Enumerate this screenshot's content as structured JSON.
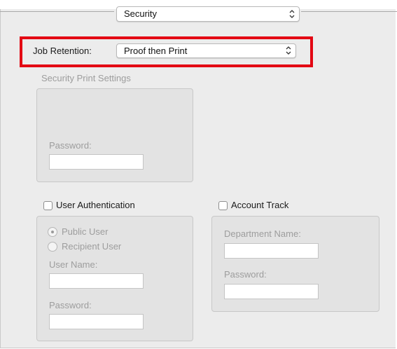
{
  "section_popup": {
    "value": "Security"
  },
  "job_retention": {
    "label": "Job Retention:",
    "value": "Proof then Print"
  },
  "security_print_settings": {
    "title": "Security Print Settings",
    "password_label": "Password:",
    "password_value": ""
  },
  "user_authentication": {
    "label": "User Authentication",
    "checked": false,
    "public_user_label": "Public User",
    "recipient_user_label": "Recipient User",
    "selected": "Public User",
    "user_name_label": "User Name:",
    "user_name_value": "",
    "password_label": "Password:",
    "password_value": ""
  },
  "account_track": {
    "label": "Account Track",
    "checked": false,
    "department_name_label": "Department Name:",
    "department_name_value": "",
    "password_label": "Password:",
    "password_value": ""
  },
  "colors": {
    "highlight": "#e30613",
    "disabled_text": "#9d9d9d",
    "pane": "#ececec",
    "group": "#e3e3e3"
  },
  "icons": {
    "popup_arrows": "updown-chevron-icon",
    "checkbox": "checkbox-icon",
    "radio": "radio-icon"
  }
}
